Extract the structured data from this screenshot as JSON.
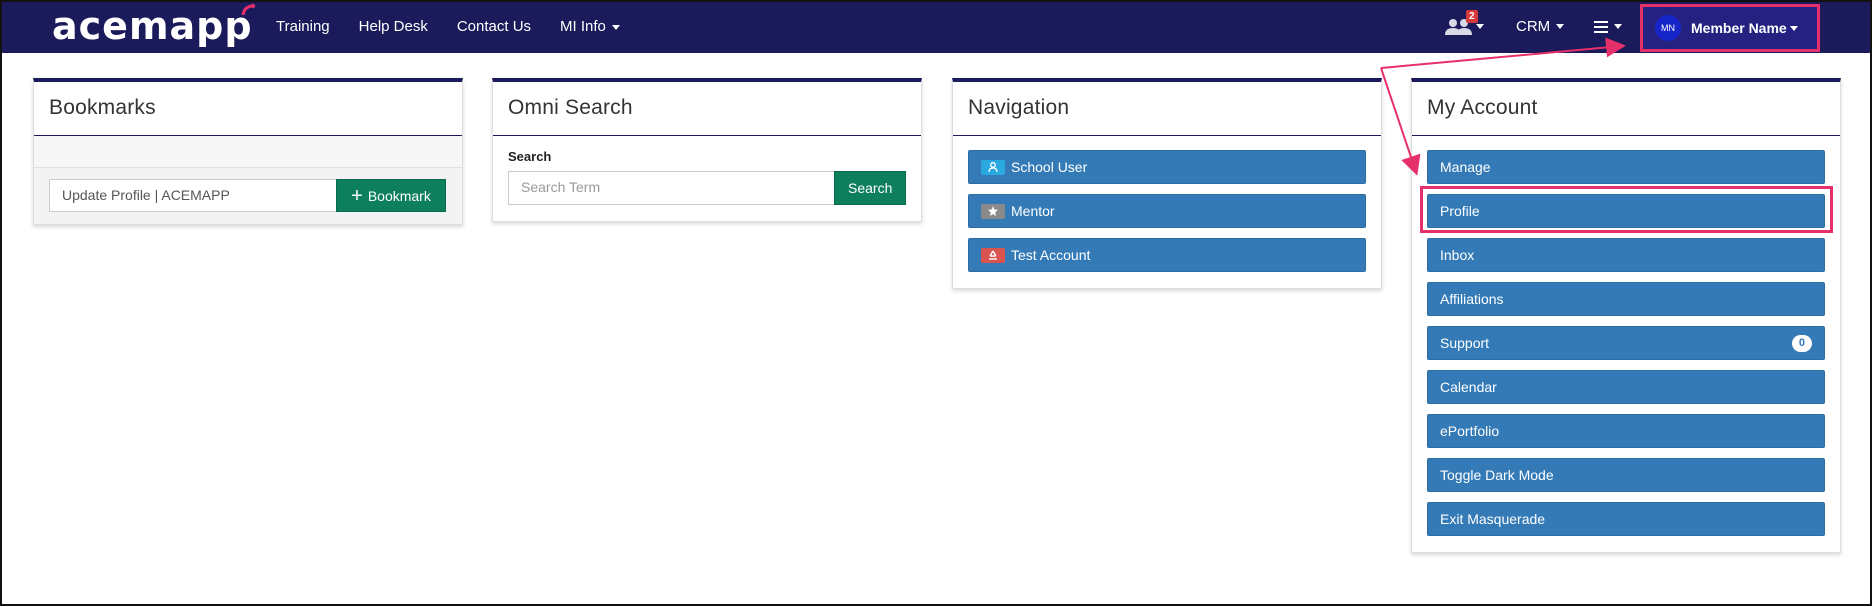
{
  "navbar": {
    "logo": "acemapp",
    "links": [
      {
        "label": "Training"
      },
      {
        "label": "Help Desk"
      },
      {
        "label": "Contact Us"
      },
      {
        "label": "MI Info",
        "dropdown": true
      }
    ],
    "notification_count": "2",
    "crm_label": "CRM",
    "member": {
      "initials": "MN",
      "name": "Member Name"
    }
  },
  "bookmarks": {
    "title": "Bookmarks",
    "input_value": "Update Profile | ACEMAPP",
    "button_label": "Bookmark"
  },
  "omni_search": {
    "title": "Omni Search",
    "field_label": "Search",
    "placeholder": "Search Term",
    "button_label": "Search"
  },
  "navigation": {
    "title": "Navigation",
    "items": [
      {
        "label": "School User",
        "icon": "user-icon",
        "icon_color": "#2aa8e0"
      },
      {
        "label": "Mentor",
        "icon": "mentor-icon",
        "icon_color": "#8a8a8a"
      },
      {
        "label": "Test Account",
        "icon": "recycle-icon",
        "icon_color": "#d9534f"
      }
    ]
  },
  "my_account": {
    "title": "My Account",
    "items": [
      {
        "label": "Manage"
      },
      {
        "label": "Profile"
      },
      {
        "label": "Inbox"
      },
      {
        "label": "Affiliations"
      },
      {
        "label": "Support",
        "badge": "0"
      },
      {
        "label": "Calendar"
      },
      {
        "label": "ePortfolio"
      },
      {
        "label": "Toggle Dark Mode"
      },
      {
        "label": "Exit Masquerade"
      }
    ]
  },
  "colors": {
    "navbar": "#1b1a5a",
    "primary_button": "#337ab7",
    "success_button": "#0d7f5d",
    "highlight": "#e6306a"
  }
}
